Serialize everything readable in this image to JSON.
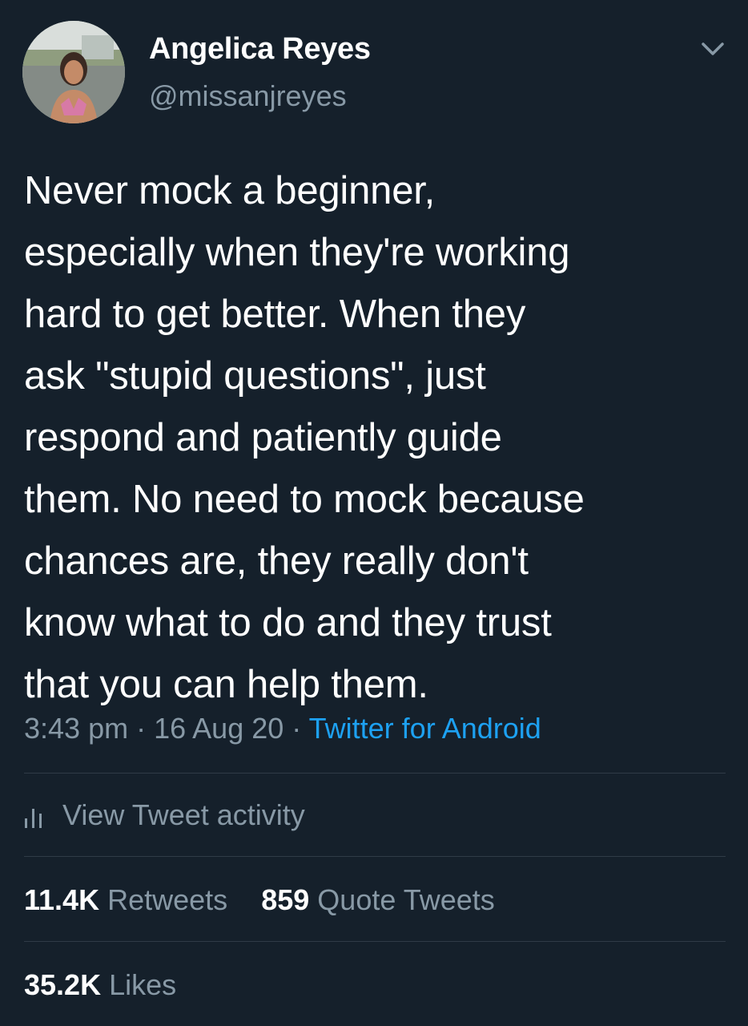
{
  "author": {
    "display_name": "Angelica Reyes",
    "handle": "@missanjreyes"
  },
  "tweet": {
    "text": "Never mock a beginner,\nespecially when they're working\nhard to get better. When they\nask \"stupid questions\", just\nrespond and patiently guide\nthem. No need to mock because\nchances are, they really don't\nknow what to do and they trust\nthat you can help them.",
    "time": "3:43 pm",
    "date": "16 Aug 20",
    "separator": "·",
    "source": "Twitter for Android"
  },
  "activity": {
    "label": "View Tweet activity"
  },
  "stats": {
    "retweets_count": "11.4K",
    "retweets_label": "Retweets",
    "quotes_count": "859",
    "quotes_label": "Quote Tweets",
    "likes_count": "35.2K",
    "likes_label": "Likes"
  },
  "icons": {
    "more": "chevron-down-icon",
    "activity": "bar-chart-icon"
  },
  "colors": {
    "background": "#15202b",
    "primary_text": "#ffffff",
    "secondary_text": "#8899a6",
    "link": "#1da1f2",
    "divider": "#2f3b47"
  }
}
